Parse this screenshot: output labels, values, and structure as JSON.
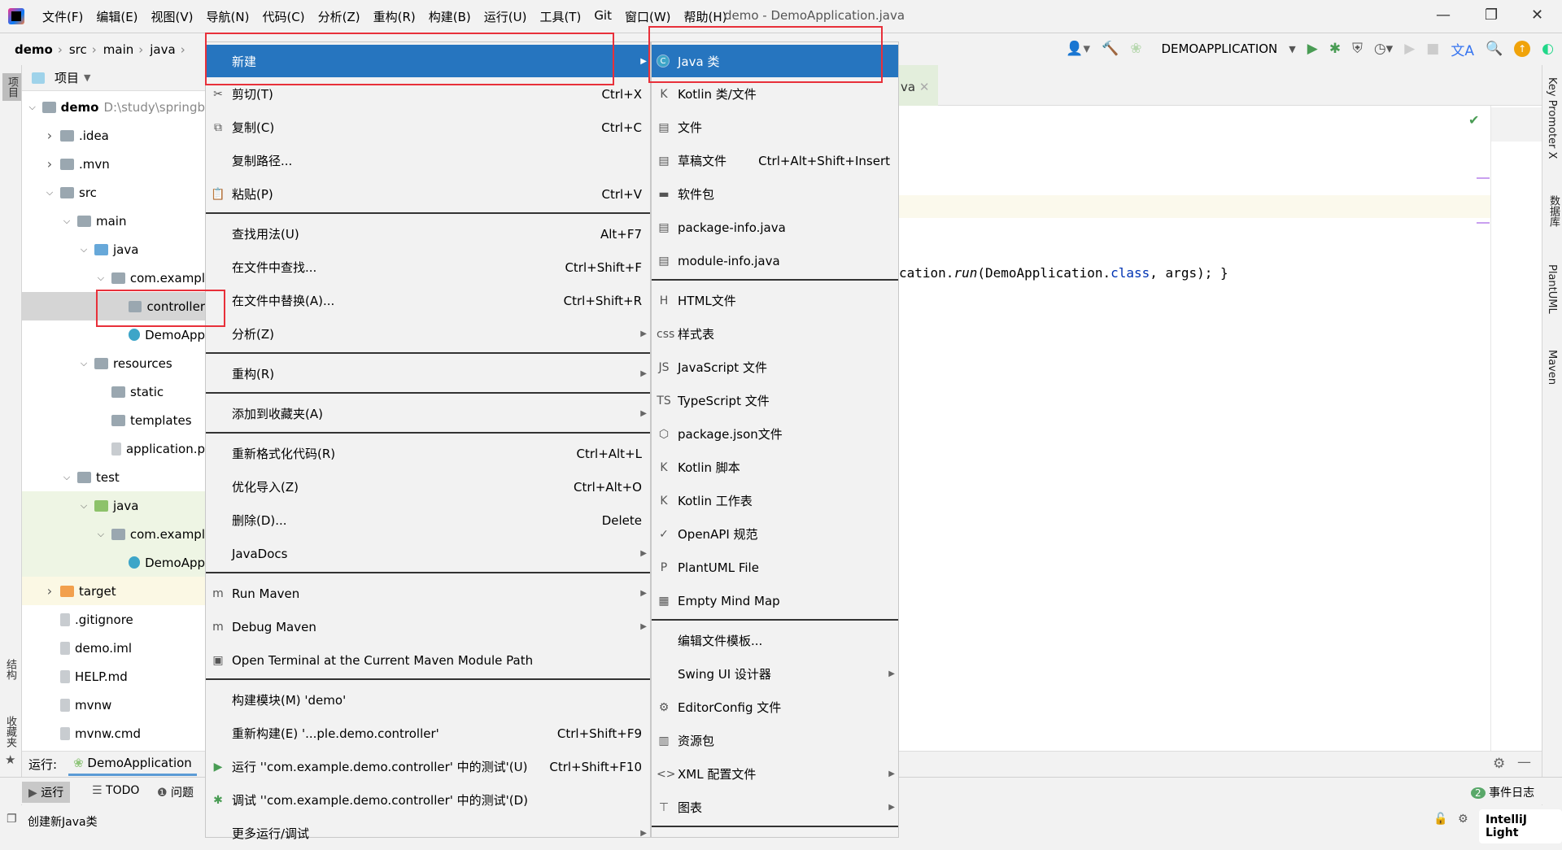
{
  "menubar": {
    "items": [
      "文件(F)",
      "编辑(E)",
      "视图(V)",
      "导航(N)",
      "代码(C)",
      "分析(Z)",
      "重构(R)",
      "构建(B)",
      "运行(U)",
      "工具(T)",
      "Git",
      "窗口(W)",
      "帮助(H)"
    ],
    "title": "demo - DemoApplication.java"
  },
  "breadcrumb": [
    "demo",
    "src",
    "main",
    "java"
  ],
  "toolbar": {
    "run_config": "DEMOAPPLICATION"
  },
  "leftstrip": {
    "project": "项目",
    "structure": "结构",
    "favorites": "收藏夹"
  },
  "project": {
    "header": "项目",
    "tree": [
      {
        "label": "demo",
        "path": "D:\\study\\springb",
        "level": 0,
        "chev": "down",
        "icon": "module",
        "bold": true
      },
      {
        "label": ".idea",
        "level": 1,
        "chev": "right",
        "icon": "folder"
      },
      {
        "label": ".mvn",
        "level": 1,
        "chev": "right",
        "icon": "folder"
      },
      {
        "label": "src",
        "level": 1,
        "chev": "down",
        "icon": "folder"
      },
      {
        "label": "main",
        "level": 2,
        "chev": "down",
        "icon": "folder"
      },
      {
        "label": "java",
        "level": 3,
        "chev": "down",
        "icon": "folder-blue"
      },
      {
        "label": "com.exampl",
        "level": 4,
        "chev": "down",
        "icon": "package"
      },
      {
        "label": "controller",
        "level": 5,
        "icon": "package",
        "selected": true
      },
      {
        "label": "DemoApp",
        "level": 5,
        "icon": "java-class"
      },
      {
        "label": "resources",
        "level": 3,
        "chev": "down",
        "icon": "folder"
      },
      {
        "label": "static",
        "level": 4,
        "icon": "folder"
      },
      {
        "label": "templates",
        "level": 4,
        "icon": "folder"
      },
      {
        "label": "application.p",
        "level": 4,
        "icon": "spring-file"
      },
      {
        "label": "test",
        "level": 2,
        "chev": "down",
        "icon": "folder"
      },
      {
        "label": "java",
        "level": 3,
        "chev": "down",
        "icon": "folder-green",
        "test": true
      },
      {
        "label": "com.exampl",
        "level": 4,
        "chev": "down",
        "icon": "package",
        "test": true
      },
      {
        "label": "DemoApp",
        "level": 5,
        "icon": "java-class",
        "test": true
      },
      {
        "label": "target",
        "level": 1,
        "chev": "right",
        "icon": "folder-orange",
        "target": true
      },
      {
        "label": ".gitignore",
        "level": 1,
        "icon": "file"
      },
      {
        "label": "demo.iml",
        "level": 1,
        "icon": "file"
      },
      {
        "label": "HELP.md",
        "level": 1,
        "icon": "md-file"
      },
      {
        "label": "mvnw",
        "level": 1,
        "icon": "file"
      },
      {
        "label": "mvnw.cmd",
        "level": 1,
        "icon": "file"
      }
    ]
  },
  "context_menu": [
    {
      "label": "新建",
      "submenu": true,
      "highlighted": true
    },
    {
      "label": "剪切(T)",
      "shortcut": "Ctrl+X",
      "icon": "✂"
    },
    {
      "label": "复制(C)",
      "shortcut": "Ctrl+C",
      "icon": "⧉"
    },
    {
      "label": "复制路径..."
    },
    {
      "label": "粘贴(P)",
      "shortcut": "Ctrl+V",
      "icon": "📋"
    },
    {
      "sep": true
    },
    {
      "label": "查找用法(U)",
      "shortcut": "Alt+F7"
    },
    {
      "label": "在文件中查找...",
      "shortcut": "Ctrl+Shift+F"
    },
    {
      "label": "在文件中替换(A)...",
      "shortcut": "Ctrl+Shift+R"
    },
    {
      "label": "分析(Z)",
      "submenu": true
    },
    {
      "sep": true
    },
    {
      "label": "重构(R)",
      "submenu": true
    },
    {
      "sep": true
    },
    {
      "label": "添加到收藏夹(A)",
      "submenu": true
    },
    {
      "sep": true
    },
    {
      "label": "重新格式化代码(R)",
      "shortcut": "Ctrl+Alt+L"
    },
    {
      "label": "优化导入(Z)",
      "shortcut": "Ctrl+Alt+O"
    },
    {
      "label": "删除(D)...",
      "shortcut": "Delete"
    },
    {
      "label": "JavaDocs",
      "submenu": true
    },
    {
      "sep": true
    },
    {
      "label": "Run Maven",
      "submenu": true,
      "icon": "m"
    },
    {
      "label": "Debug Maven",
      "submenu": true,
      "icon": "m"
    },
    {
      "label": "Open Terminal at the Current Maven Module Path",
      "icon": "▣"
    },
    {
      "sep": true
    },
    {
      "label": "构建模块(M) 'demo'"
    },
    {
      "label": "重新构建(E) '...ple.demo.controller'",
      "shortcut": "Ctrl+Shift+F9"
    },
    {
      "label": "运行 ''com.example.demo.controller' 中的测试'(U)",
      "shortcut": "Ctrl+Shift+F10",
      "icon": "▶"
    },
    {
      "label": "调试 ''com.example.demo.controller' 中的测试'(D)",
      "icon": "✱"
    },
    {
      "label": "更多运行/调试",
      "submenu": true
    }
  ],
  "new_submenu": [
    {
      "label": "Java 类",
      "highlighted": true,
      "icon": "C"
    },
    {
      "label": "Kotlin 类/文件",
      "icon": "K"
    },
    {
      "label": "文件",
      "icon": "▤"
    },
    {
      "label": "草稿文件",
      "shortcut": "Ctrl+Alt+Shift+Insert",
      "icon": "▤"
    },
    {
      "label": "软件包",
      "icon": "▬"
    },
    {
      "label": "package-info.java",
      "icon": "▤"
    },
    {
      "label": "module-info.java",
      "icon": "▤"
    },
    {
      "sep": true
    },
    {
      "label": "HTML文件",
      "icon": "H"
    },
    {
      "label": "样式表",
      "icon": "css"
    },
    {
      "label": "JavaScript 文件",
      "icon": "JS"
    },
    {
      "label": "TypeScript 文件",
      "icon": "TS"
    },
    {
      "label": "package.json文件",
      "icon": "⬡"
    },
    {
      "label": "Kotlin 脚本",
      "icon": "K"
    },
    {
      "label": "Kotlin 工作表",
      "icon": "K"
    },
    {
      "label": "OpenAPI 规范",
      "icon": "✓"
    },
    {
      "label": "PlantUML File",
      "icon": "P"
    },
    {
      "label": "Empty Mind Map",
      "icon": "▦"
    },
    {
      "sep": true
    },
    {
      "label": "编辑文件模板..."
    },
    {
      "label": "Swing UI 设计器",
      "submenu": true
    },
    {
      "label": "EditorConfig 文件",
      "icon": "⚙"
    },
    {
      "label": "资源包",
      "icon": "▥"
    },
    {
      "label": "XML 配置文件",
      "submenu": true,
      "icon": "<>"
    },
    {
      "label": "图表",
      "submenu": true,
      "icon": "⊤"
    },
    {
      "sep": true
    }
  ],
  "editor": {
    "tab_label": "va",
    "code_tokens": [
      {
        "t": "cation."
      },
      {
        "t": "run",
        "c": "it"
      },
      {
        "t": "(DemoApplication."
      },
      {
        "t": "class",
        "c": "kw"
      },
      {
        "t": ", args); }"
      }
    ]
  },
  "rightstrip": {
    "key_promoter": "Key Promoter X",
    "database": "数据库",
    "plantuml": "PlantUML",
    "maven": "Maven"
  },
  "runbar": {
    "label": "运行:",
    "config": "DemoApplication"
  },
  "tooltabs": {
    "run": "运行",
    "todo": "TODO",
    "problems": "问题"
  },
  "status": {
    "message": "创建新Java类",
    "event_count": "2",
    "event_log": "事件日志",
    "theme": "IntelliJ Light"
  },
  "colors": {
    "highlight": "#2675bf",
    "redbox": "#e8303a"
  }
}
